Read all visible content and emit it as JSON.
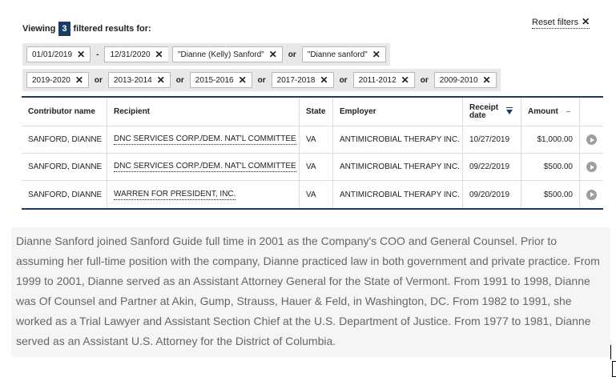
{
  "header": {
    "reset_label": "Reset filters",
    "viewing_prefix": "Viewing",
    "count": "3",
    "viewing_suffix": "filtered results for:"
  },
  "filters": {
    "date_from": "01/01/2019",
    "date_to": "12/31/2020",
    "date_sep": "-",
    "name_1": "\"Dianne (Kelly) Sanford\"",
    "name_2": "\"Dianne sanford\"",
    "or": "or",
    "cycles": [
      "2019-2020",
      "2013-2014",
      "2015-2016",
      "2017-2018",
      "2011-2012",
      "2009-2010"
    ]
  },
  "table": {
    "headers": {
      "contributor": "Contributor name",
      "recipient": "Recipient",
      "state": "State",
      "employer": "Employer",
      "receipt_line1": "Receipt",
      "receipt_line2": "date",
      "amount": "Amount",
      "amount_toggle": "–"
    },
    "rows": [
      {
        "contributor": "SANFORD, DIANNE",
        "recipient": "DNC SERVICES CORP./DEM. NAT'L COMMITTEE",
        "state": "VA",
        "employer": "ANTIMICROBIAL THERAPY INC.",
        "date": "10/27/2019",
        "amount": "$1,000.00"
      },
      {
        "contributor": "SANFORD, DIANNE",
        "recipient": "DNC SERVICES CORP./DEM. NAT'L COMMITTEE",
        "state": "VA",
        "employer": "ANTIMICROBIAL THERAPY INC.",
        "date": "09/22/2019",
        "amount": "$500.00"
      },
      {
        "contributor": "SANFORD, DIANNE",
        "recipient": "WARREN FOR PRESIDENT, INC.",
        "state": "VA",
        "employer": "ANTIMICROBIAL THERAPY INC.",
        "date": "09/20/2019",
        "amount": "$500.00"
      }
    ]
  },
  "bio": "Dianne Sanford joined Sanford Guide full time in 2001 as the Company's COO and General Counsel. Prior to assuming her full-time position with the company, Dianne practiced law in both government and private practice. From 1999 to 2001, Dianne served as an Assistant Attorney General for the State of Vermont. From 1991 to 1998, Dianne was Of Counsel and Partner at Akin, Gump, Strauss, Hauer & Feld, in Washington, DC. From 1982 to 1991, she worked as a Trial Lawyer and Assistant Section Chief at the U.S. Department of Justice. From 1977 to 1981, Dianne served as an Assistant U.S. Attorney for the District of Columbia.",
  "colors": {
    "accent": "#1a3b63",
    "tag_bg": "#e8e8e8",
    "bio_bg": "#f5f5f5"
  }
}
